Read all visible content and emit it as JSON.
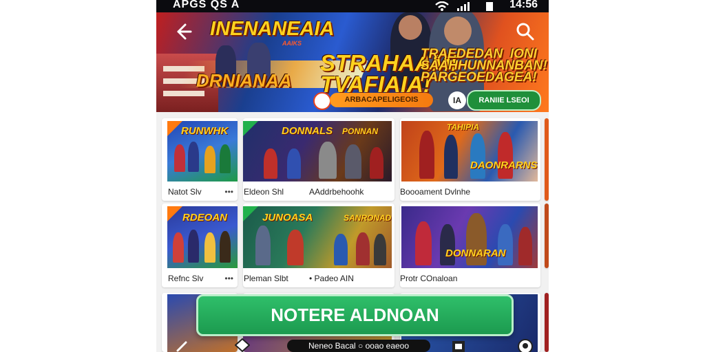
{
  "status_bar": {
    "left_text": "APGS  QS  A",
    "time": "14:56"
  },
  "banner": {
    "title1": "INENANEAIA",
    "subtitle1": "AAIKS",
    "title2": "DRNIANAA",
    "title3": "STRAHAAMI\nTVAFIAIA!",
    "title4": "TRAEDEDAN  IONI\nSAAHHUNNANBAN!\nPARGEOEDAGEA!",
    "promo_text": "ARBACAPELIGEOIS",
    "circle_label": "IA",
    "cta_label": "RANIIE LSEOI"
  },
  "cards": [
    {
      "caption": "Natot Slv",
      "thumb_title": "RUNWHK",
      "badge": "orange"
    },
    {
      "caption": "Eldeon Shl",
      "caption2": "AAddrbehoohk",
      "thumb_title": "DONNALS",
      "thumb_title2": "PONNAN",
      "badge": "green"
    },
    {
      "caption": "Boooament Dvlnhe",
      "thumb_title": "DAONRARNS",
      "thumb_title2": "TAHIPIA",
      "badge": ""
    },
    {
      "caption": "Refnc Slv",
      "thumb_title": "RDEOAN",
      "badge": "orange"
    },
    {
      "caption": "Pleman Slbt",
      "caption2": "• Padeo AIN",
      "thumb_title": "JUNOASA",
      "thumb_title2": "SANRONAD",
      "badge": "green"
    },
    {
      "caption": "Protr COnaloan",
      "thumb_title": "DONNARAN",
      "badge": ""
    }
  ],
  "more_dots": "•••",
  "install_button": "NOTERE ALDNOAN",
  "bottom_pill": "Neneo Bacal   ○   ooao eaeoo"
}
